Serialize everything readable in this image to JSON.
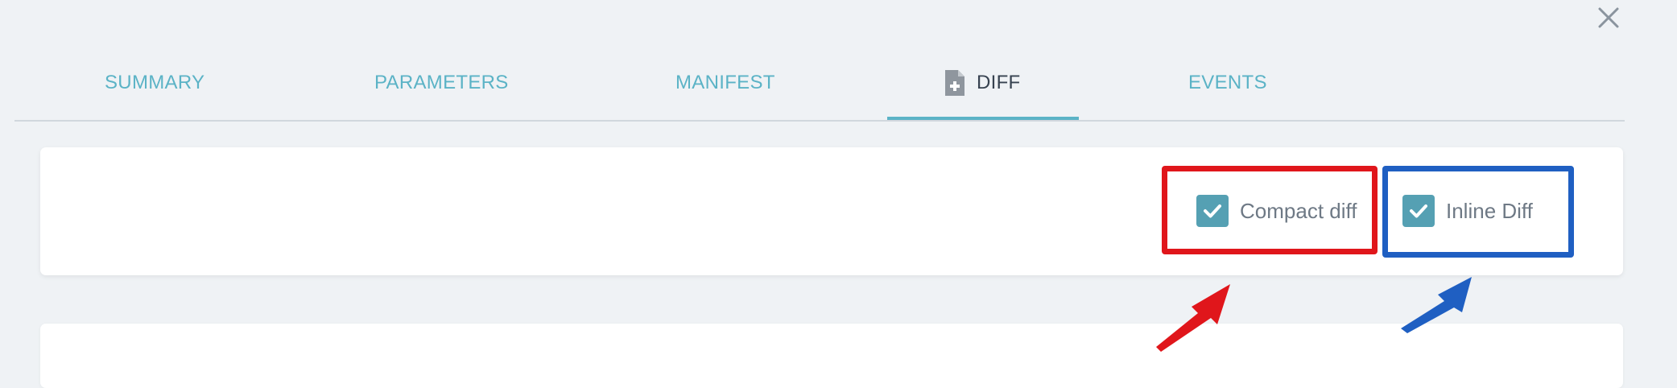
{
  "dialog": {
    "close_icon": "close-icon"
  },
  "tabs": [
    {
      "label": "SUMMARY",
      "active": false
    },
    {
      "label": "PARAMETERS",
      "active": false
    },
    {
      "label": "MANIFEST",
      "active": false
    },
    {
      "label": "DIFF",
      "active": true,
      "icon": "file-plus-icon"
    },
    {
      "label": "EVENTS",
      "active": false
    }
  ],
  "options": {
    "compact_diff": {
      "label": "Compact diff",
      "checked": true
    },
    "inline_diff": {
      "label": "Inline Diff",
      "checked": true
    }
  },
  "annotations": {
    "red_color": "#e0161b",
    "blue_color": "#1f5fc2"
  },
  "colors": {
    "accent": "#5bb3c6",
    "checkbox": "#55a0b3",
    "active_tab_text": "#374250",
    "background": "#eff2f5"
  }
}
